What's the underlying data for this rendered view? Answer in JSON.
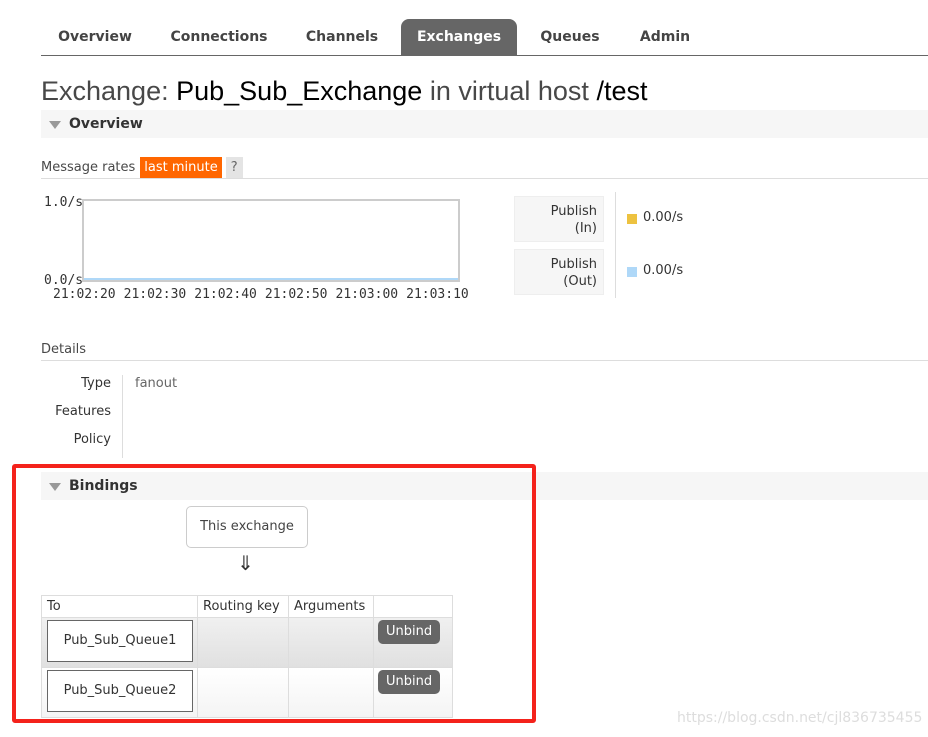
{
  "nav": {
    "tabs": [
      "Overview",
      "Connections",
      "Channels",
      "Exchanges",
      "Queues",
      "Admin"
    ],
    "active": "Exchanges"
  },
  "title": {
    "prefix": "Exchange:",
    "name": "Pub_Sub_Exchange",
    "mid": "in virtual host",
    "vhost": "/test"
  },
  "overview": {
    "header": "Overview",
    "message_rates_label": "Message rates",
    "range": "last minute",
    "help": "?",
    "chart": {
      "type": "line",
      "y_ticks": [
        "1.0/s",
        "0.0/s"
      ],
      "x_ticks": [
        "21:02:20",
        "21:02:30",
        "21:02:40",
        "21:02:50",
        "21:03:00",
        "21:03:10"
      ],
      "ylim": [
        0,
        1
      ]
    },
    "legend": [
      {
        "label_1": "Publish",
        "label_2": "(In)",
        "value": "0.00/s",
        "color": "#edc240"
      },
      {
        "label_1": "Publish",
        "label_2": "(Out)",
        "value": "0.00/s",
        "color": "#afd8f8"
      }
    ]
  },
  "details": {
    "header": "Details",
    "rows": [
      {
        "label": "Type",
        "value": "fanout"
      },
      {
        "label": "Features",
        "value": ""
      },
      {
        "label": "Policy",
        "value": ""
      }
    ]
  },
  "bindings": {
    "header": "Bindings",
    "source": "This exchange",
    "arrow": "⇓",
    "columns": [
      "To",
      "Routing key",
      "Arguments",
      ""
    ],
    "rows": [
      {
        "to": "Pub_Sub_Queue1",
        "routing_key": "",
        "arguments": "",
        "action": "Unbind"
      },
      {
        "to": "Pub_Sub_Queue2",
        "routing_key": "",
        "arguments": "",
        "action": "Unbind"
      }
    ]
  },
  "watermark": "https://blog.csdn.net/cjl836735455",
  "highlight_color": "#f4221b"
}
